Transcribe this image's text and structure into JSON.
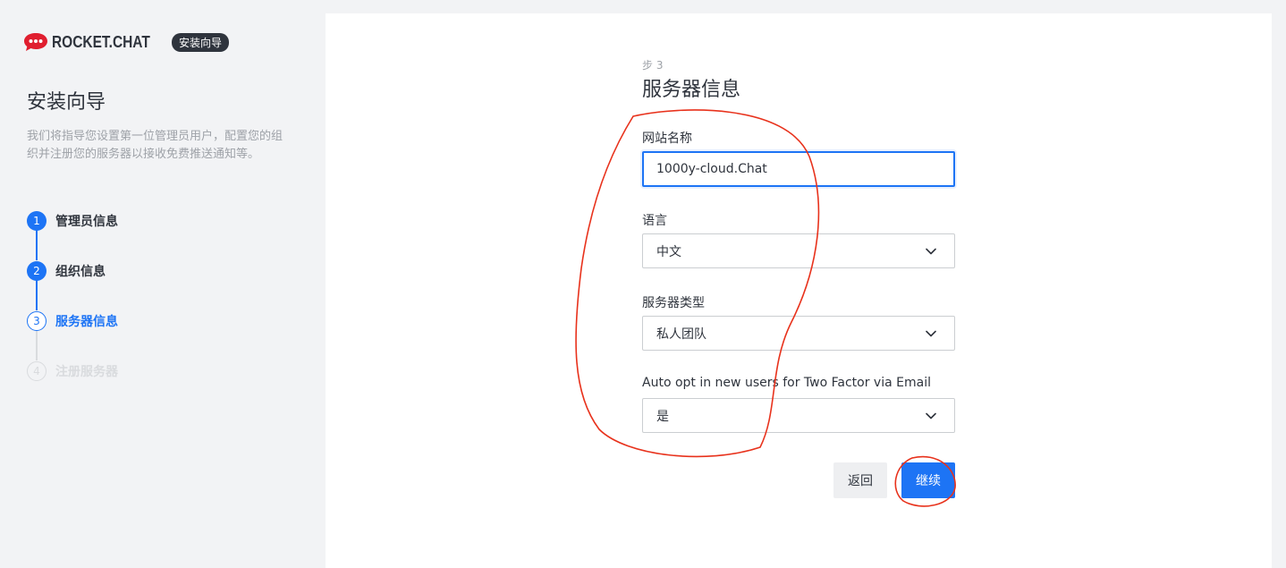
{
  "brand": {
    "name": "ROCKET.CHAT",
    "badge": "安装向导",
    "logo_icon": "rocket-chat-logo-icon",
    "logo_color": "#e01e2f"
  },
  "sidebar": {
    "title": "安装向导",
    "description": "我们将指导您设置第一位管理员用户，配置您的组织并注册您的服务器以接收免费推送通知等。",
    "steps": [
      {
        "number": "1",
        "label": "管理员信息",
        "state": "done"
      },
      {
        "number": "2",
        "label": "组织信息",
        "state": "done"
      },
      {
        "number": "3",
        "label": "服务器信息",
        "state": "current"
      },
      {
        "number": "4",
        "label": "注册服务器",
        "state": "future"
      }
    ]
  },
  "form": {
    "step_indicator": "步 3",
    "title": "服务器信息",
    "site_name": {
      "label": "网站名称",
      "value": "1000y-cloud.Chat"
    },
    "language": {
      "label": "语言",
      "value": "中文"
    },
    "server_type": {
      "label": "服务器类型",
      "value": "私人团队"
    },
    "two_factor": {
      "label": "Auto opt in new users for Two Factor via Email",
      "value": "是"
    },
    "back_label": "返回",
    "continue_label": "继续"
  },
  "colors": {
    "primary": "#1d74f5",
    "text": "#2f343d",
    "muted": "#9ea2a8",
    "annotation": "#e8321c"
  }
}
